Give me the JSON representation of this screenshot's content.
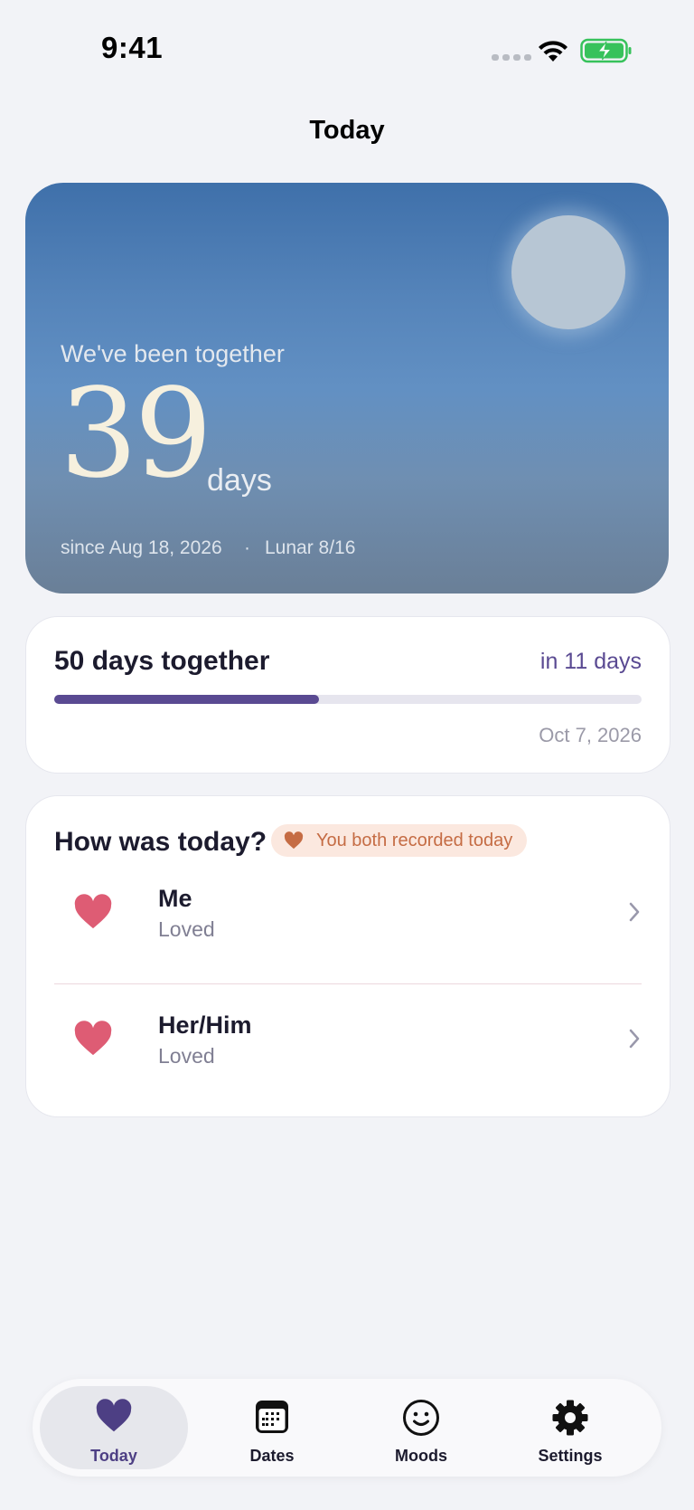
{
  "status_bar": {
    "time": "9:41"
  },
  "header": {
    "title": "Today"
  },
  "hero": {
    "caption": "We've been together",
    "count": "39",
    "unit": "days",
    "since": "since Aug 18, 2026",
    "separator": "·",
    "lunar": "Lunar 8/16"
  },
  "milestone": {
    "title": "50 days together",
    "countdown": "in 11 days",
    "date": "Oct 7, 2026",
    "progress": 0.45
  },
  "mood": {
    "title": "How was today?",
    "badge": "You both recorded today",
    "rows": [
      {
        "who": "Me",
        "feeling": "Loved",
        "icon": "heart-icon"
      },
      {
        "who": "Her/Him",
        "feeling": "Loved",
        "icon": "heart-icon"
      }
    ]
  },
  "tabs": [
    {
      "label": "Today",
      "icon": "heart-icon",
      "active": true
    },
    {
      "label": "Dates",
      "icon": "calendar-icon",
      "active": false
    },
    {
      "label": "Moods",
      "icon": "smiley-icon",
      "active": false
    },
    {
      "label": "Settings",
      "icon": "gear-icon",
      "active": false
    }
  ],
  "colors": {
    "accent": "#5a4a92",
    "heart": "#de5c74",
    "badge_text": "#c56c44",
    "background": "#f2f3f7"
  }
}
